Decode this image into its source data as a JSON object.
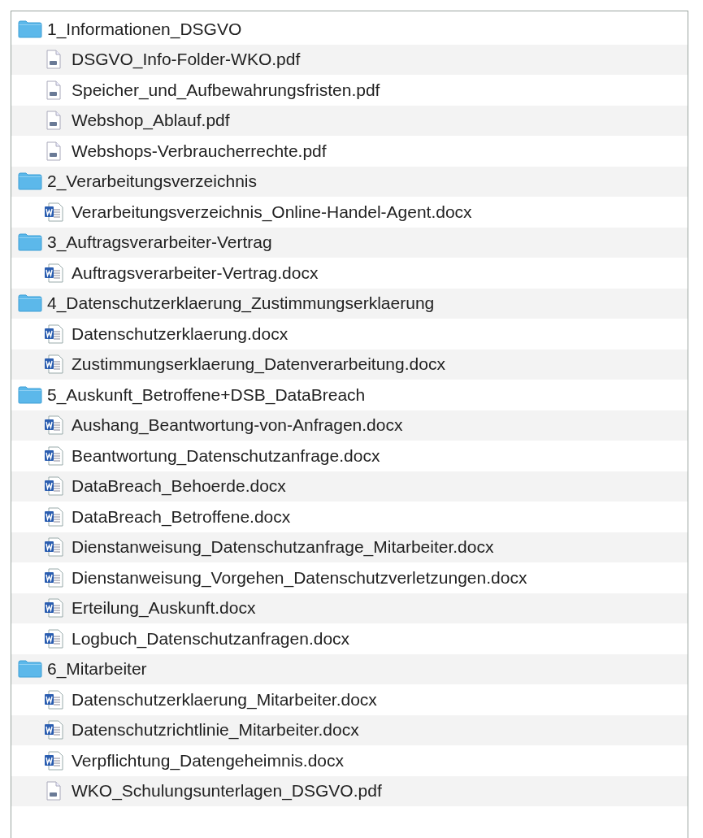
{
  "folders": [
    {
      "name": "1_Informationen_DSGVO",
      "children": [
        {
          "name": "DSGVO_Info-Folder-WKO.pdf",
          "kind": "pdf"
        },
        {
          "name": "Speicher_und_Aufbewahrungsfristen.pdf",
          "kind": "pdf"
        },
        {
          "name": "Webshop_Ablauf.pdf",
          "kind": "pdf"
        },
        {
          "name": "Webshops-Verbraucherrechte.pdf",
          "kind": "pdf"
        }
      ]
    },
    {
      "name": "2_Verarbeitungsverzeichnis",
      "children": [
        {
          "name": "Verarbeitungsverzeichnis_Online-Handel-Agent.docx",
          "kind": "word"
        }
      ]
    },
    {
      "name": "3_Auftragsverarbeiter-Vertrag",
      "children": [
        {
          "name": "Auftragsverarbeiter-Vertrag.docx",
          "kind": "word"
        }
      ]
    },
    {
      "name": "4_Datenschutzerklaerung_Zustimmungserklaerung",
      "children": [
        {
          "name": "Datenschutzerklaerung.docx",
          "kind": "word"
        },
        {
          "name": "Zustimmungserklaerung_Datenverarbeitung.docx",
          "kind": "word"
        }
      ]
    },
    {
      "name": "5_Auskunft_Betroffene+DSB_DataBreach",
      "children": [
        {
          "name": "Aushang_Beantwortung-von-Anfragen.docx",
          "kind": "word"
        },
        {
          "name": "Beantwortung_Datenschutzanfrage.docx",
          "kind": "word"
        },
        {
          "name": "DataBreach_Behoerde.docx",
          "kind": "word"
        },
        {
          "name": "DataBreach_Betroffene.docx",
          "kind": "word"
        },
        {
          "name": "Dienstanweisung_Datenschutzanfrage_Mitarbeiter.docx",
          "kind": "word"
        },
        {
          "name": "Dienstanweisung_Vorgehen_Datenschutzverletzungen.docx",
          "kind": "word"
        },
        {
          "name": "Erteilung_Auskunft.docx",
          "kind": "word"
        },
        {
          "name": "Logbuch_Datenschutzanfragen.docx",
          "kind": "word"
        }
      ]
    },
    {
      "name": "6_Mitarbeiter",
      "children": [
        {
          "name": "Datenschutzerklaerung_Mitarbeiter.docx",
          "kind": "word"
        },
        {
          "name": "Datenschutzrichtlinie_Mitarbeiter.docx",
          "kind": "word"
        },
        {
          "name": "Verpflichtung_Datengeheimnis.docx",
          "kind": "word"
        },
        {
          "name": "WKO_Schulungsunterlagen_DSGVO.pdf",
          "kind": "pdf"
        }
      ]
    }
  ]
}
